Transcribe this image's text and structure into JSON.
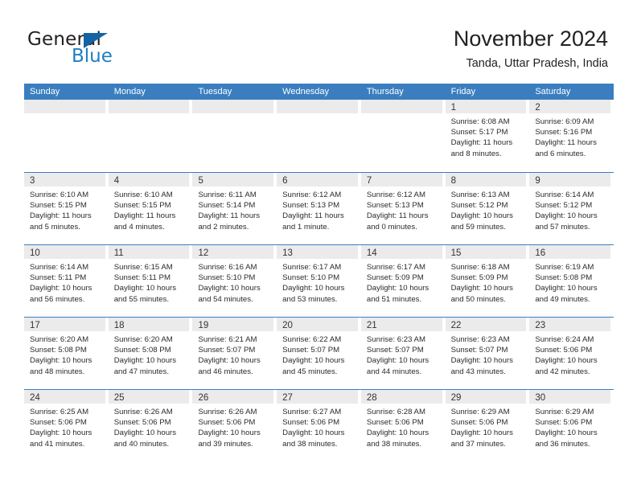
{
  "brand": {
    "name_part1": "General",
    "name_part2": "Blue",
    "accent_color": "#1f7fc4",
    "triangle_color": "#1464a5"
  },
  "header": {
    "title": "November 2024",
    "subtitle": "Tanda, Uttar Pradesh, India"
  },
  "calendar": {
    "header_bg": "#3a7ebf",
    "day_band_bg": "#ebebeb",
    "weekday_names": [
      "Sunday",
      "Monday",
      "Tuesday",
      "Wednesday",
      "Thursday",
      "Friday",
      "Saturday"
    ],
    "labels": {
      "sunrise": "Sunrise:",
      "sunset": "Sunset:",
      "daylight": "Daylight:"
    },
    "weeks": [
      [
        {
          "day": "",
          "empty": true
        },
        {
          "day": "",
          "empty": true
        },
        {
          "day": "",
          "empty": true
        },
        {
          "day": "",
          "empty": true
        },
        {
          "day": "",
          "empty": true
        },
        {
          "day": "1",
          "sunrise": "Sunrise: 6:08 AM",
          "sunset": "Sunset: 5:17 PM",
          "daylight_l1": "Daylight: 11 hours",
          "daylight_l2": "and 8 minutes."
        },
        {
          "day": "2",
          "sunrise": "Sunrise: 6:09 AM",
          "sunset": "Sunset: 5:16 PM",
          "daylight_l1": "Daylight: 11 hours",
          "daylight_l2": "and 6 minutes."
        }
      ],
      [
        {
          "day": "3",
          "sunrise": "Sunrise: 6:10 AM",
          "sunset": "Sunset: 5:15 PM",
          "daylight_l1": "Daylight: 11 hours",
          "daylight_l2": "and 5 minutes."
        },
        {
          "day": "4",
          "sunrise": "Sunrise: 6:10 AM",
          "sunset": "Sunset: 5:15 PM",
          "daylight_l1": "Daylight: 11 hours",
          "daylight_l2": "and 4 minutes."
        },
        {
          "day": "5",
          "sunrise": "Sunrise: 6:11 AM",
          "sunset": "Sunset: 5:14 PM",
          "daylight_l1": "Daylight: 11 hours",
          "daylight_l2": "and 2 minutes."
        },
        {
          "day": "6",
          "sunrise": "Sunrise: 6:12 AM",
          "sunset": "Sunset: 5:13 PM",
          "daylight_l1": "Daylight: 11 hours",
          "daylight_l2": "and 1 minute."
        },
        {
          "day": "7",
          "sunrise": "Sunrise: 6:12 AM",
          "sunset": "Sunset: 5:13 PM",
          "daylight_l1": "Daylight: 11 hours",
          "daylight_l2": "and 0 minutes."
        },
        {
          "day": "8",
          "sunrise": "Sunrise: 6:13 AM",
          "sunset": "Sunset: 5:12 PM",
          "daylight_l1": "Daylight: 10 hours",
          "daylight_l2": "and 59 minutes."
        },
        {
          "day": "9",
          "sunrise": "Sunrise: 6:14 AM",
          "sunset": "Sunset: 5:12 PM",
          "daylight_l1": "Daylight: 10 hours",
          "daylight_l2": "and 57 minutes."
        }
      ],
      [
        {
          "day": "10",
          "sunrise": "Sunrise: 6:14 AM",
          "sunset": "Sunset: 5:11 PM",
          "daylight_l1": "Daylight: 10 hours",
          "daylight_l2": "and 56 minutes."
        },
        {
          "day": "11",
          "sunrise": "Sunrise: 6:15 AM",
          "sunset": "Sunset: 5:11 PM",
          "daylight_l1": "Daylight: 10 hours",
          "daylight_l2": "and 55 minutes."
        },
        {
          "day": "12",
          "sunrise": "Sunrise: 6:16 AM",
          "sunset": "Sunset: 5:10 PM",
          "daylight_l1": "Daylight: 10 hours",
          "daylight_l2": "and 54 minutes."
        },
        {
          "day": "13",
          "sunrise": "Sunrise: 6:17 AM",
          "sunset": "Sunset: 5:10 PM",
          "daylight_l1": "Daylight: 10 hours",
          "daylight_l2": "and 53 minutes."
        },
        {
          "day": "14",
          "sunrise": "Sunrise: 6:17 AM",
          "sunset": "Sunset: 5:09 PM",
          "daylight_l1": "Daylight: 10 hours",
          "daylight_l2": "and 51 minutes."
        },
        {
          "day": "15",
          "sunrise": "Sunrise: 6:18 AM",
          "sunset": "Sunset: 5:09 PM",
          "daylight_l1": "Daylight: 10 hours",
          "daylight_l2": "and 50 minutes."
        },
        {
          "day": "16",
          "sunrise": "Sunrise: 6:19 AM",
          "sunset": "Sunset: 5:08 PM",
          "daylight_l1": "Daylight: 10 hours",
          "daylight_l2": "and 49 minutes."
        }
      ],
      [
        {
          "day": "17",
          "sunrise": "Sunrise: 6:20 AM",
          "sunset": "Sunset: 5:08 PM",
          "daylight_l1": "Daylight: 10 hours",
          "daylight_l2": "and 48 minutes."
        },
        {
          "day": "18",
          "sunrise": "Sunrise: 6:20 AM",
          "sunset": "Sunset: 5:08 PM",
          "daylight_l1": "Daylight: 10 hours",
          "daylight_l2": "and 47 minutes."
        },
        {
          "day": "19",
          "sunrise": "Sunrise: 6:21 AM",
          "sunset": "Sunset: 5:07 PM",
          "daylight_l1": "Daylight: 10 hours",
          "daylight_l2": "and 46 minutes."
        },
        {
          "day": "20",
          "sunrise": "Sunrise: 6:22 AM",
          "sunset": "Sunset: 5:07 PM",
          "daylight_l1": "Daylight: 10 hours",
          "daylight_l2": "and 45 minutes."
        },
        {
          "day": "21",
          "sunrise": "Sunrise: 6:23 AM",
          "sunset": "Sunset: 5:07 PM",
          "daylight_l1": "Daylight: 10 hours",
          "daylight_l2": "and 44 minutes."
        },
        {
          "day": "22",
          "sunrise": "Sunrise: 6:23 AM",
          "sunset": "Sunset: 5:07 PM",
          "daylight_l1": "Daylight: 10 hours",
          "daylight_l2": "and 43 minutes."
        },
        {
          "day": "23",
          "sunrise": "Sunrise: 6:24 AM",
          "sunset": "Sunset: 5:06 PM",
          "daylight_l1": "Daylight: 10 hours",
          "daylight_l2": "and 42 minutes."
        }
      ],
      [
        {
          "day": "24",
          "sunrise": "Sunrise: 6:25 AM",
          "sunset": "Sunset: 5:06 PM",
          "daylight_l1": "Daylight: 10 hours",
          "daylight_l2": "and 41 minutes."
        },
        {
          "day": "25",
          "sunrise": "Sunrise: 6:26 AM",
          "sunset": "Sunset: 5:06 PM",
          "daylight_l1": "Daylight: 10 hours",
          "daylight_l2": "and 40 minutes."
        },
        {
          "day": "26",
          "sunrise": "Sunrise: 6:26 AM",
          "sunset": "Sunset: 5:06 PM",
          "daylight_l1": "Daylight: 10 hours",
          "daylight_l2": "and 39 minutes."
        },
        {
          "day": "27",
          "sunrise": "Sunrise: 6:27 AM",
          "sunset": "Sunset: 5:06 PM",
          "daylight_l1": "Daylight: 10 hours",
          "daylight_l2": "and 38 minutes."
        },
        {
          "day": "28",
          "sunrise": "Sunrise: 6:28 AM",
          "sunset": "Sunset: 5:06 PM",
          "daylight_l1": "Daylight: 10 hours",
          "daylight_l2": "and 38 minutes."
        },
        {
          "day": "29",
          "sunrise": "Sunrise: 6:29 AM",
          "sunset": "Sunset: 5:06 PM",
          "daylight_l1": "Daylight: 10 hours",
          "daylight_l2": "and 37 minutes."
        },
        {
          "day": "30",
          "sunrise": "Sunrise: 6:29 AM",
          "sunset": "Sunset: 5:06 PM",
          "daylight_l1": "Daylight: 10 hours",
          "daylight_l2": "and 36 minutes."
        }
      ]
    ]
  }
}
